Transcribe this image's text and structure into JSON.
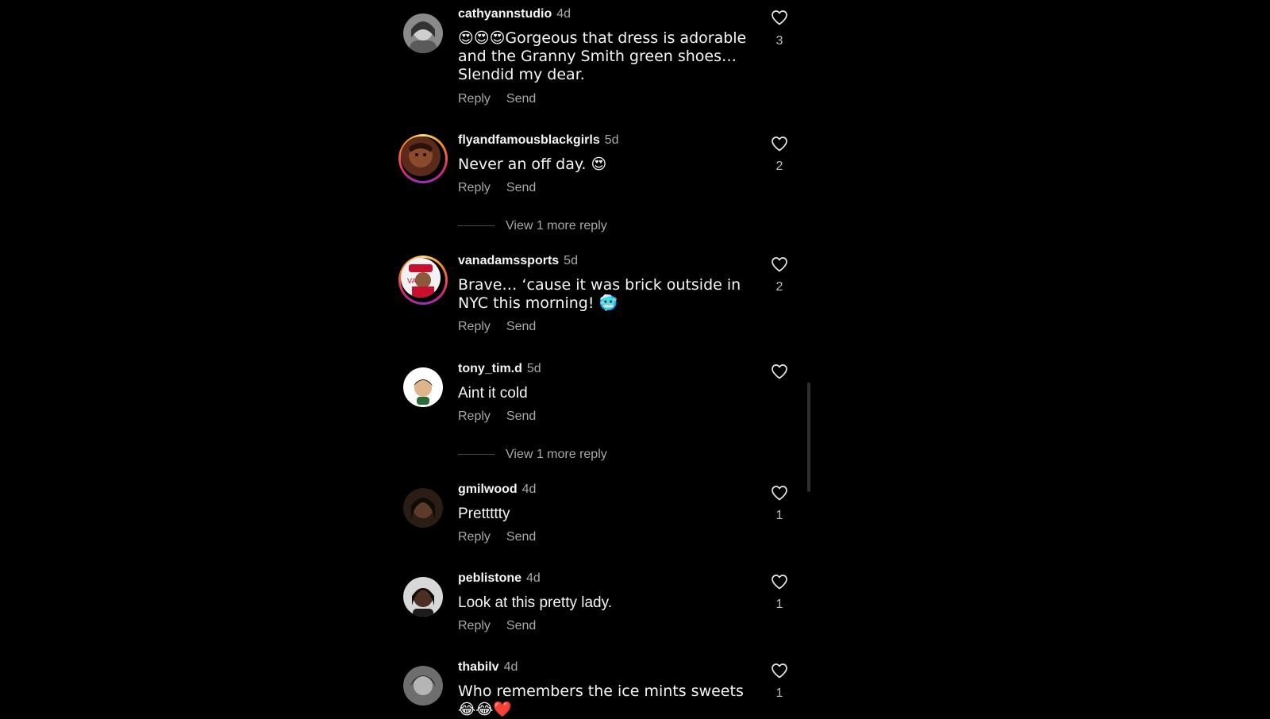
{
  "comments": [
    {
      "username": "cathyannstudio",
      "time": "4d",
      "text": "😍😍😍Gorgeous that dress is adorable and the Granny Smith green shoes…Slendid my dear.",
      "reply_label": "Reply",
      "send_label": "Send",
      "likes": "3"
    },
    {
      "username": "flyandfamousblackgirls",
      "time": "5d",
      "text": "Never an off day. 😍",
      "reply_label": "Reply",
      "send_label": "Send",
      "likes": "2",
      "more_replies": "View 1 more reply"
    },
    {
      "username": "vanadamssports",
      "time": "5d",
      "text": "Brave… ‘cause it was brick outside in NYC this morning! 🥶",
      "reply_label": "Reply",
      "send_label": "Send",
      "likes": "2"
    },
    {
      "username": "tony_tim.d",
      "time": "5d",
      "text": "Aint it cold",
      "reply_label": "Reply",
      "send_label": "Send",
      "likes": "",
      "more_replies": "View 1 more reply"
    },
    {
      "username": "gmilwood",
      "time": "4d",
      "text": "Prettttty",
      "reply_label": "Reply",
      "send_label": "Send",
      "likes": "1"
    },
    {
      "username": "peblistone",
      "time": "4d",
      "text": "Look at this pretty lady.",
      "reply_label": "Reply",
      "send_label": "Send",
      "likes": "1"
    },
    {
      "username": "thabilv",
      "time": "4d",
      "text": "Who remembers the ice mints sweets 😂😂❤️",
      "reply_label": "",
      "send_label": "",
      "likes": "1"
    }
  ],
  "colors": {
    "background": "#000000",
    "text_primary": "#f5f5f5",
    "text_secondary": "#a8a8a8",
    "story_ring": "#d62976"
  },
  "icons": {
    "like": "heart-outline-icon"
  }
}
